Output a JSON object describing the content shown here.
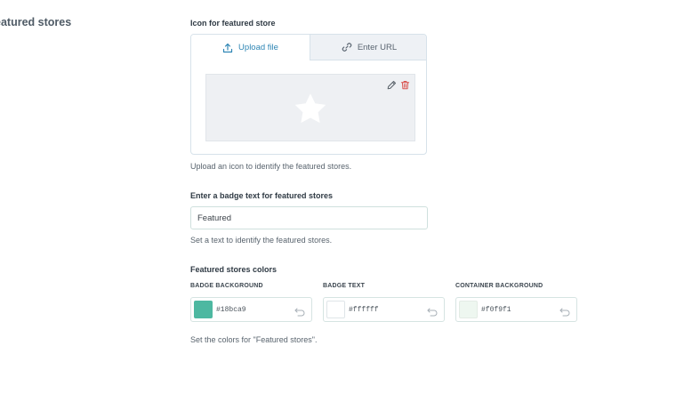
{
  "section": {
    "title": "eatured stores"
  },
  "icon_field": {
    "label": "Icon for featured store",
    "tabs": [
      {
        "label": "Upload file",
        "icon": "upload-icon",
        "active": true
      },
      {
        "label": "Enter URL",
        "icon": "link-icon",
        "active": false
      }
    ],
    "preview_icon": "star-icon",
    "actions": [
      "edit-icon",
      "trash-icon"
    ],
    "help": "Upload an icon to identify the featured stores."
  },
  "badge_field": {
    "label": "Enter a badge text for featured stores",
    "value": "Featured",
    "help": "Set a text to identify the featured stores."
  },
  "colors_field": {
    "label": "Featured stores colors",
    "items": [
      {
        "label": "BADGE BACKGROUND",
        "hex": "#18bca9",
        "color": "#4db8a1"
      },
      {
        "label": "BADGE TEXT",
        "hex": "#ffffff",
        "color": "#ffffff"
      },
      {
        "label": "CONTAINER BACKGROUND",
        "hex": "#f0f9f1",
        "color": "#eef7f0"
      }
    ],
    "help": "Set the colors for \"Featured stores\"."
  },
  "colors": {
    "accent": "#2f86b5",
    "danger": "#d9534f"
  }
}
